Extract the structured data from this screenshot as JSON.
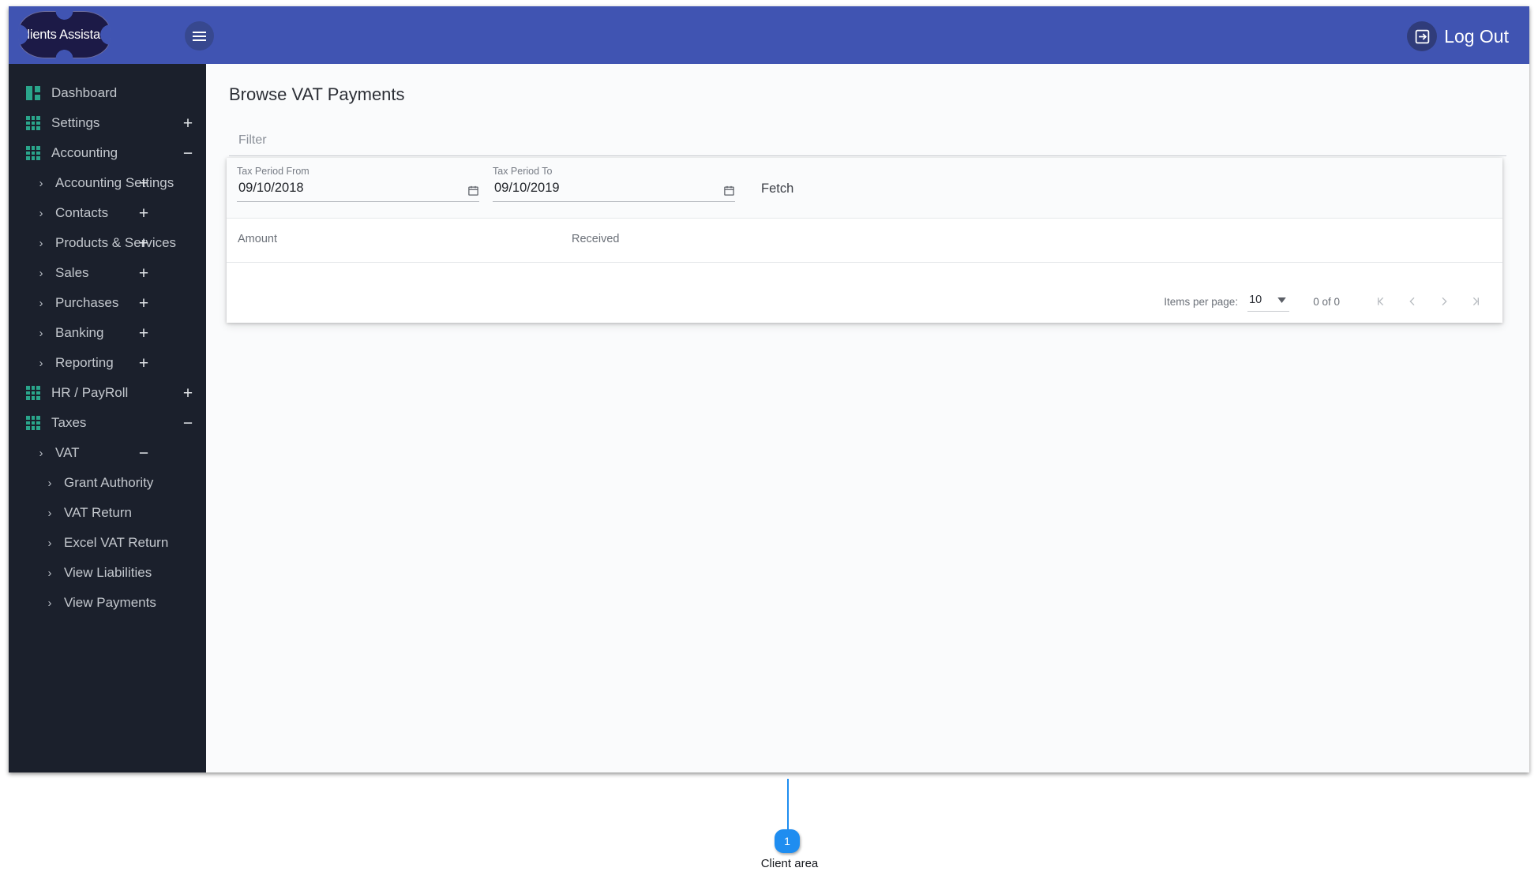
{
  "colors": {
    "header_blue": "#4054b2",
    "sidebar_dark": "#1b202c",
    "icon_teal": "#2aa58b",
    "logo_navy": "#1c1a47",
    "annotation_blue": "#1f8df0"
  },
  "header": {
    "logo_text": "Clients Assistant",
    "menu_icon": "hamburger-menu-icon",
    "logout_label": "Log Out",
    "logout_icon": "logout-arrow-icon"
  },
  "sidebar": {
    "items": [
      {
        "label": "Dashboard",
        "level": 0,
        "icon": "grid-2x2-icon",
        "toggle": ""
      },
      {
        "label": "Settings",
        "level": 0,
        "icon": "grid-3x3-icon",
        "toggle": "+"
      },
      {
        "label": "Accounting",
        "level": 0,
        "icon": "grid-3x3-icon",
        "toggle": "−"
      },
      {
        "label": "Accounting Settings",
        "level": 1,
        "icon": "chevron-right-icon",
        "toggle": "+"
      },
      {
        "label": "Contacts",
        "level": 1,
        "icon": "chevron-right-icon",
        "toggle": "+"
      },
      {
        "label": "Products & Services",
        "level": 1,
        "icon": "chevron-right-icon",
        "toggle": "+"
      },
      {
        "label": "Sales",
        "level": 1,
        "icon": "chevron-right-icon",
        "toggle": "+"
      },
      {
        "label": "Purchases",
        "level": 1,
        "icon": "chevron-right-icon",
        "toggle": "+"
      },
      {
        "label": "Banking",
        "level": 1,
        "icon": "chevron-right-icon",
        "toggle": "+"
      },
      {
        "label": "Reporting",
        "level": 1,
        "icon": "chevron-right-icon",
        "toggle": "+"
      },
      {
        "label": "HR / PayRoll",
        "level": 0,
        "icon": "grid-3x3-icon",
        "toggle": "+"
      },
      {
        "label": "Taxes",
        "level": 0,
        "icon": "grid-3x3-icon",
        "toggle": "−"
      },
      {
        "label": "VAT",
        "level": 1,
        "icon": "chevron-right-icon",
        "toggle": "−"
      },
      {
        "label": "Grant Authority",
        "level": 2,
        "icon": "chevron-right-icon",
        "toggle": ""
      },
      {
        "label": "VAT Return",
        "level": 2,
        "icon": "chevron-right-icon",
        "toggle": ""
      },
      {
        "label": "Excel VAT Return",
        "level": 2,
        "icon": "chevron-right-icon",
        "toggle": ""
      },
      {
        "label": "View Liabilities",
        "level": 2,
        "icon": "chevron-right-icon",
        "toggle": ""
      },
      {
        "label": "View Payments",
        "level": 2,
        "icon": "chevron-right-icon",
        "toggle": ""
      }
    ]
  },
  "main": {
    "page_title": "Browse VAT Payments",
    "filter": {
      "value": "",
      "placeholder": "Filter"
    },
    "tax_period_from": {
      "label": "Tax Period From",
      "value": "09/10/2018",
      "icon": "calendar-icon"
    },
    "tax_period_to": {
      "label": "Tax Period To",
      "value": "09/10/2019",
      "icon": "calendar-icon"
    },
    "fetch_label": "Fetch",
    "table": {
      "columns": [
        "Amount",
        "Received"
      ],
      "rows": []
    },
    "paginator": {
      "items_per_page_label": "Items per page:",
      "items_per_page_value": "10",
      "range_label": "0 of 0",
      "first_icon": "first-page-icon",
      "prev_icon": "previous-page-icon",
      "next_icon": "next-page-icon",
      "last_icon": "last-page-icon"
    }
  },
  "annotation": {
    "number": "1",
    "label": "Client area"
  }
}
